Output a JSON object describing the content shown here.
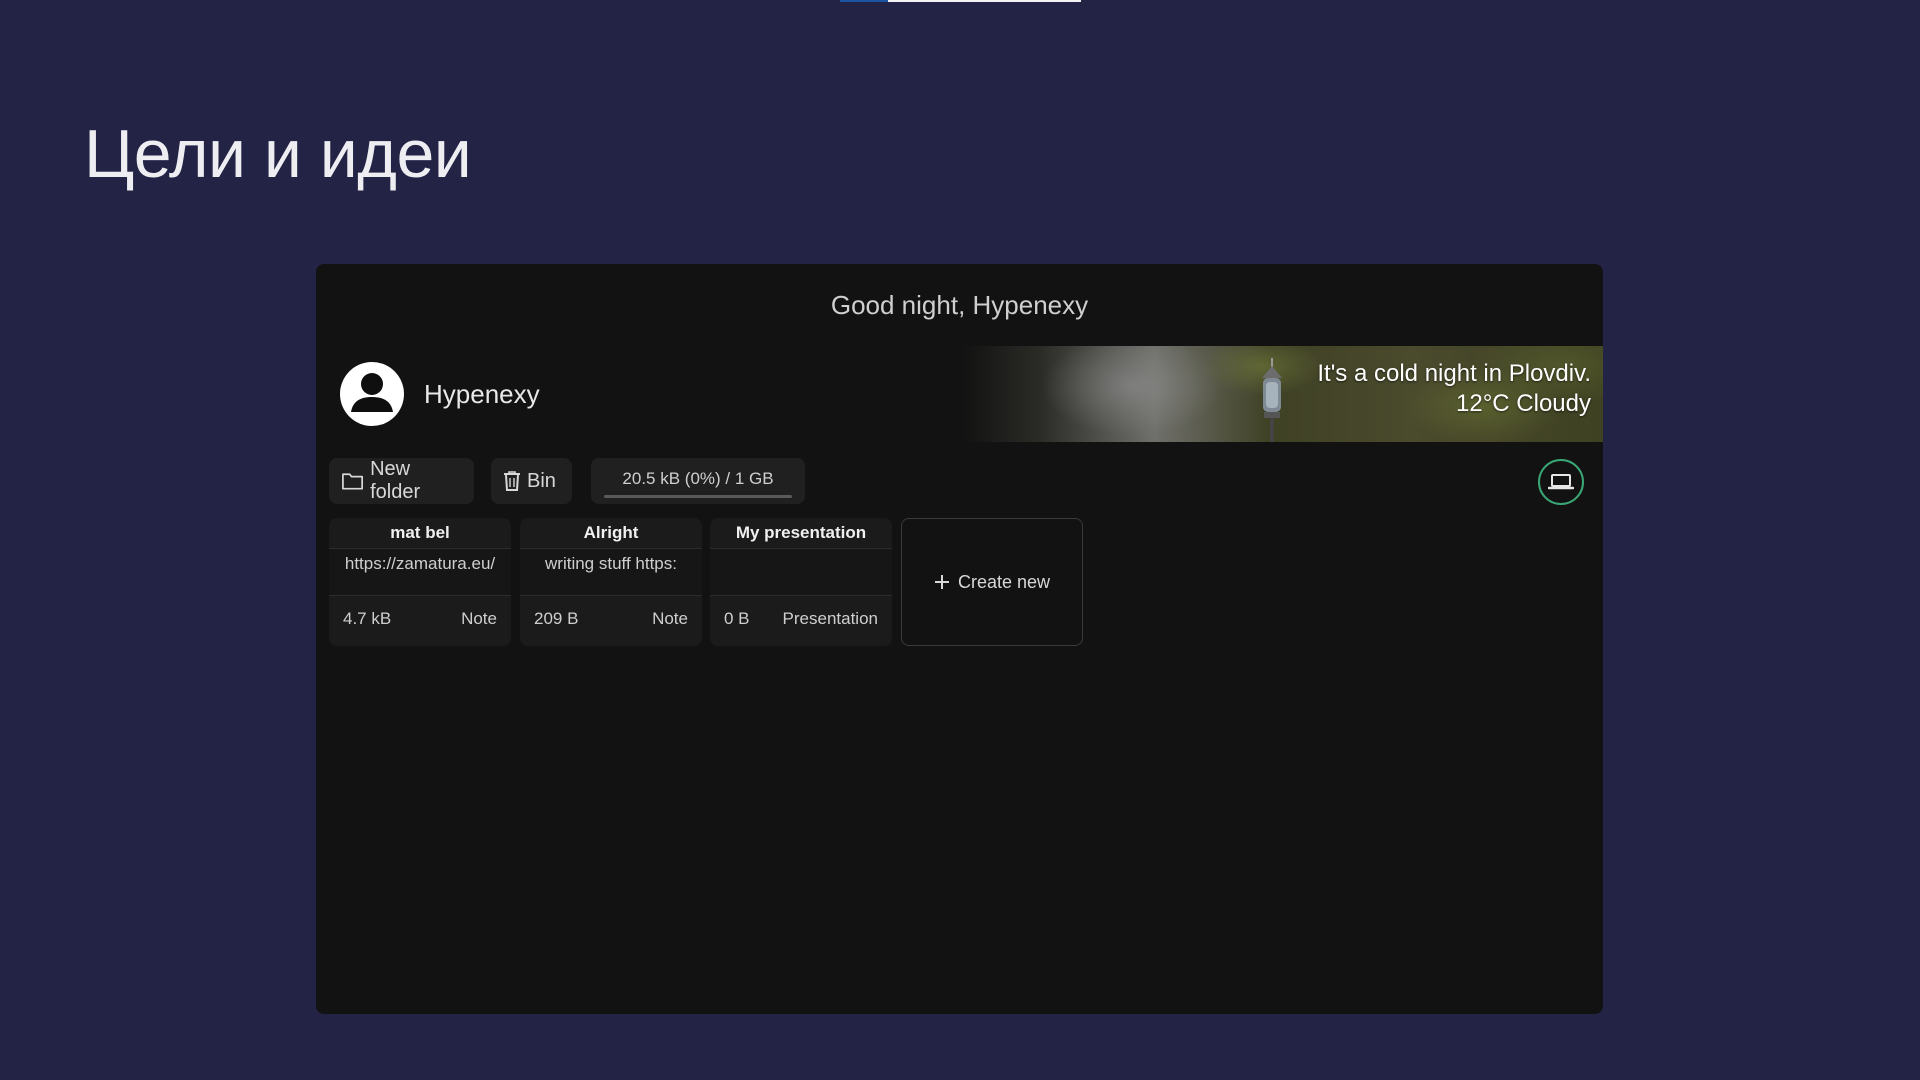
{
  "slide": {
    "title": "Цели и идеи",
    "progress": 0.2
  },
  "app": {
    "greeting": "Good night, Hypenexy",
    "user": {
      "name": "Hypenexy"
    },
    "weather": {
      "line1": "It's a cold night in Plovdiv.",
      "line2": "12°C Cloudy"
    },
    "toolbar": {
      "new_folder_label": "New folder",
      "bin_label": "Bin",
      "storage_label": "20.5 kB (0%) / 1 GB",
      "storage_fraction": 0.0
    },
    "files": [
      {
        "name": "mat bel",
        "preview": "https://zamatura.eu/",
        "size": "4.7 kB",
        "type": "Note"
      },
      {
        "name": "Alright",
        "preview": "writing stuff https:",
        "size": "209 B",
        "type": "Note"
      },
      {
        "name": "My presentation",
        "preview": "",
        "size": "0 B",
        "type": "Presentation"
      }
    ],
    "create_new_label": "Create new",
    "accent_color": "#3aa776"
  }
}
